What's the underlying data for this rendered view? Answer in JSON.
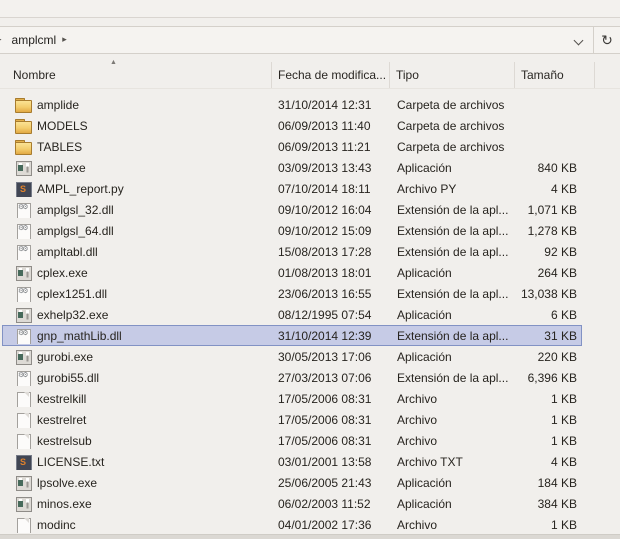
{
  "address_bar": {
    "breadcrumb": "amplcml",
    "refresh_glyph": "↻"
  },
  "columns": {
    "nombre": "Nombre",
    "fecha": "Fecha de modifica...",
    "tipo": "Tipo",
    "tamano": "Tamaño",
    "sort_arrow": "▲"
  },
  "colors": {
    "selection_bg": "#c6cbe6",
    "selection_border": "#8292c4",
    "window_bg": "#f1efec",
    "folder_yellow": "#f3cd6d"
  },
  "rows": [
    {
      "name": "amplide",
      "icon": "folder",
      "date": "31/10/2014 12:31",
      "type": "Carpeta de archivos",
      "size": "",
      "selected": false
    },
    {
      "name": "MODELS",
      "icon": "folder",
      "date": "06/09/2013 11:40",
      "type": "Carpeta de archivos",
      "size": "",
      "selected": false
    },
    {
      "name": "TABLES",
      "icon": "folder",
      "date": "06/09/2013 11:21",
      "type": "Carpeta de archivos",
      "size": "",
      "selected": false
    },
    {
      "name": "ampl.exe",
      "icon": "app",
      "date": "03/09/2013 13:43",
      "type": "Aplicación",
      "size": "840 KB",
      "selected": false
    },
    {
      "name": "AMPL_report.py",
      "icon": "sublime",
      "date": "07/10/2014 18:11",
      "type": "Archivo PY",
      "size": "4 KB",
      "selected": false
    },
    {
      "name": "amplgsl_32.dll",
      "icon": "dll",
      "date": "09/10/2012 16:04",
      "type": "Extensión de la apl...",
      "size": "1,071 KB",
      "selected": false
    },
    {
      "name": "amplgsl_64.dll",
      "icon": "dll",
      "date": "09/10/2012 15:09",
      "type": "Extensión de la apl...",
      "size": "1,278 KB",
      "selected": false
    },
    {
      "name": "ampltabl.dll",
      "icon": "dll",
      "date": "15/08/2013 17:28",
      "type": "Extensión de la apl...",
      "size": "92 KB",
      "selected": false
    },
    {
      "name": "cplex.exe",
      "icon": "app",
      "date": "01/08/2013 18:01",
      "type": "Aplicación",
      "size": "264 KB",
      "selected": false
    },
    {
      "name": "cplex1251.dll",
      "icon": "dll",
      "date": "23/06/2013 16:55",
      "type": "Extensión de la apl...",
      "size": "13,038 KB",
      "selected": false
    },
    {
      "name": "exhelp32.exe",
      "icon": "app",
      "date": "08/12/1995 07:54",
      "type": "Aplicación",
      "size": "6 KB",
      "selected": false
    },
    {
      "name": "gnp_mathLib.dll",
      "icon": "dll",
      "date": "31/10/2014 12:39",
      "type": "Extensión de la apl...",
      "size": "31 KB",
      "selected": true
    },
    {
      "name": "gurobi.exe",
      "icon": "app",
      "date": "30/05/2013 17:06",
      "type": "Aplicación",
      "size": "220 KB",
      "selected": false
    },
    {
      "name": "gurobi55.dll",
      "icon": "dll",
      "date": "27/03/2013 07:06",
      "type": "Extensión de la apl...",
      "size": "6,396 KB",
      "selected": false
    },
    {
      "name": "kestrelkill",
      "icon": "file",
      "date": "17/05/2006 08:31",
      "type": "Archivo",
      "size": "1 KB",
      "selected": false
    },
    {
      "name": "kestrelret",
      "icon": "file",
      "date": "17/05/2006 08:31",
      "type": "Archivo",
      "size": "1 KB",
      "selected": false
    },
    {
      "name": "kestrelsub",
      "icon": "file",
      "date": "17/05/2006 08:31",
      "type": "Archivo",
      "size": "1 KB",
      "selected": false
    },
    {
      "name": "LICENSE.txt",
      "icon": "sublime",
      "date": "03/01/2001 13:58",
      "type": "Archivo TXT",
      "size": "4 KB",
      "selected": false
    },
    {
      "name": "lpsolve.exe",
      "icon": "app",
      "date": "25/06/2005 21:43",
      "type": "Aplicación",
      "size": "184 KB",
      "selected": false
    },
    {
      "name": "minos.exe",
      "icon": "app",
      "date": "06/02/2003 11:52",
      "type": "Aplicación",
      "size": "384 KB",
      "selected": false
    },
    {
      "name": "modinc",
      "icon": "file",
      "date": "04/01/2002 17:36",
      "type": "Archivo",
      "size": "1 KB",
      "selected": false
    }
  ]
}
